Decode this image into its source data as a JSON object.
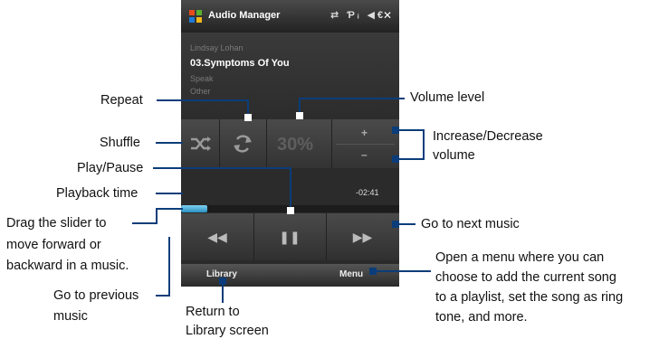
{
  "device": {
    "title": "Audio Manager",
    "status_icons": "⇄ Ƥᵢ ◀€",
    "close_label": "✕",
    "artist": "Lindsay Lohan",
    "song": "03.Symptoms Of You",
    "album": "Speak",
    "genre": "Other",
    "volume": "30%",
    "plus": "+",
    "minus": "–",
    "time": "-02:41",
    "progress": 0.12,
    "prev": "◀◀",
    "pause": "❚❚",
    "next": "▶▶",
    "softkey_left": "Library",
    "softkey_right": "Menu"
  },
  "callouts": {
    "repeat": "Repeat",
    "volume_level": "Volume level",
    "shuffle": "Shuffle",
    "increase_decrease_1": "Increase/Decrease",
    "increase_decrease_2": "volume",
    "play_pause": "Play/Pause",
    "playback_time": "Playback time",
    "drag_1": "Drag the slider to",
    "drag_2": "move forward or",
    "drag_3": "backward in a music.",
    "next_music": "Go to next music",
    "menu_1": "Open a menu where you can",
    "menu_2": "choose to add the current song",
    "menu_3": "to a playlist, set the song as ring",
    "menu_4": "tone, and more.",
    "prev_1": "Go to previous",
    "prev_2": "music",
    "library_1": "Return to",
    "library_2": "Library screen"
  }
}
